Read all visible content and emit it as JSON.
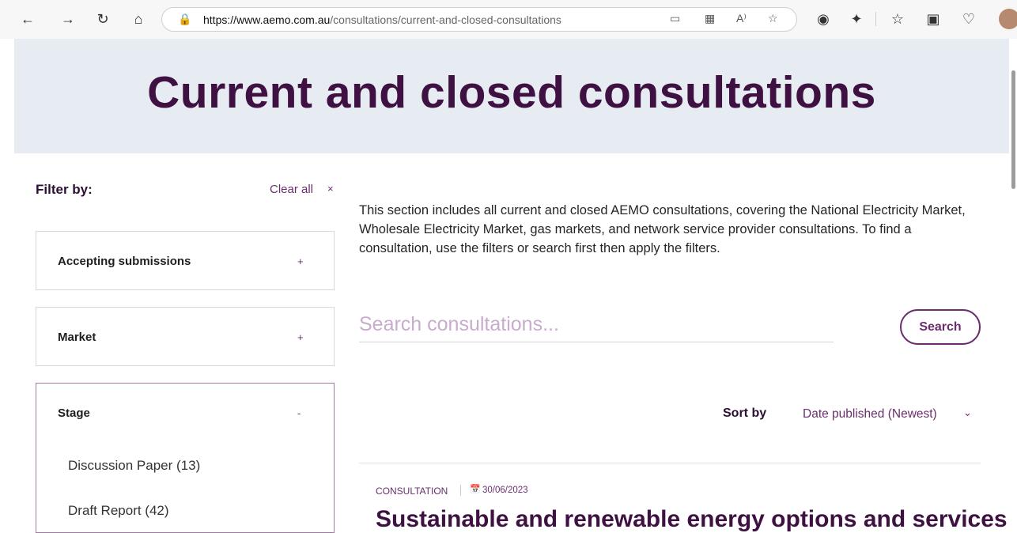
{
  "browser": {
    "url_prefix": "https://www.aemo.com.au",
    "url_path": "/consultations/current-and-closed-consultations",
    "icons": [
      "back-icon",
      "forward-icon",
      "refresh-icon",
      "home-icon",
      "lock-icon",
      "tab-icon",
      "grid-icon",
      "read-aloud-icon",
      "star-icon",
      "extension-icon",
      "puzzle-icon",
      "favorites-icon",
      "collections-icon",
      "heart-icon",
      "profile-avatar"
    ]
  },
  "hero": {
    "title": "Current and closed consultations"
  },
  "filters": {
    "title": "Filter by:",
    "clear_all": "Clear all",
    "clear_icon": "×",
    "facets": [
      {
        "label": "Accepting submissions",
        "toggle": "+"
      },
      {
        "label": "Market",
        "toggle": "+"
      },
      {
        "label": "Stage",
        "toggle": "-",
        "options": [
          "Discussion Paper (13)",
          "Draft Report (42)"
        ]
      }
    ]
  },
  "intro": "This section includes all current and closed AEMO consultations, covering the National Electricity Market, Wholesale Electricity Market, gas markets, and network service provider consultations. To find a consultation, use the filters or search first then apply the filters.",
  "search": {
    "placeholder": "Search consultations...",
    "button": "Search"
  },
  "sort": {
    "label": "Sort by",
    "value": "Date published (Newest)",
    "chevron": "⌄"
  },
  "results": [
    {
      "type": "CONSULTATION",
      "date": "30/06/2023",
      "title": "Sustainable and renewable energy options and services"
    }
  ],
  "colors": {
    "brand": "#3f1142",
    "accent": "#6a2e6e",
    "hero_bg": "#e7ecf2"
  }
}
